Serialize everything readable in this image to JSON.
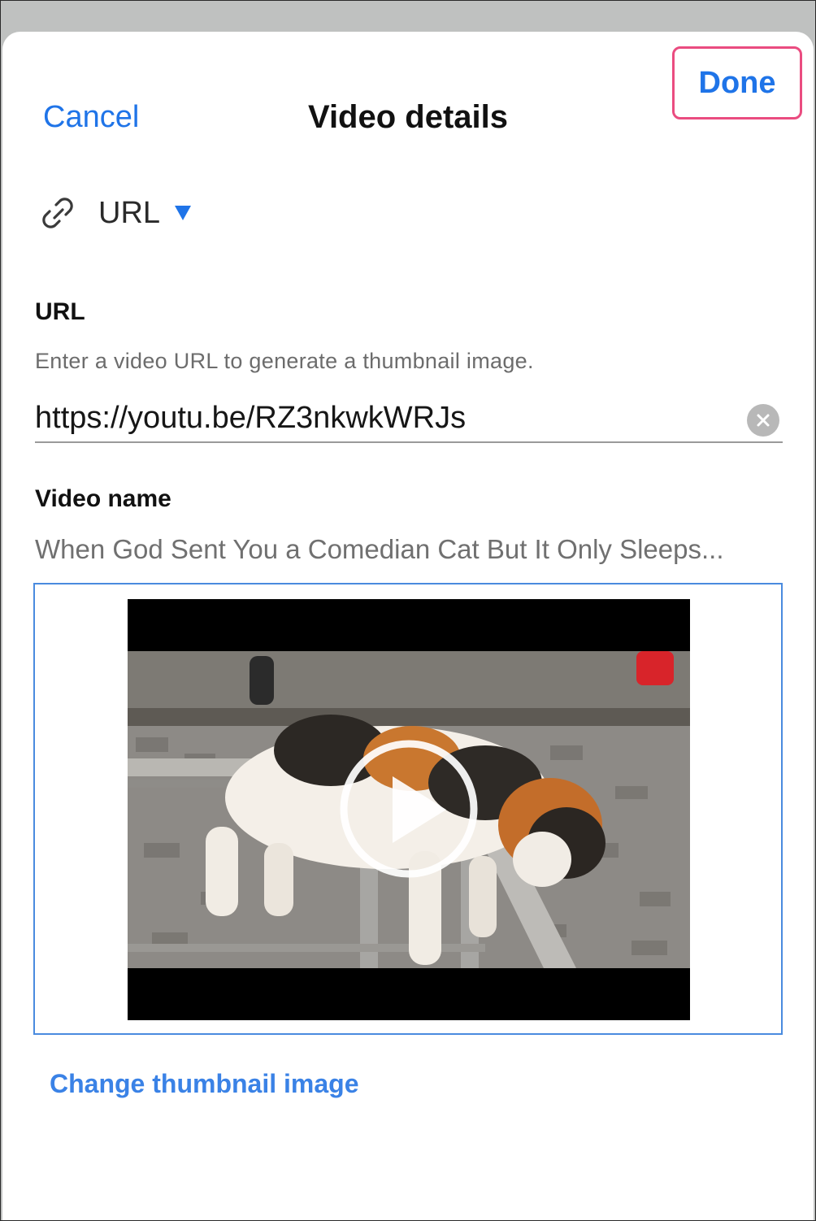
{
  "header": {
    "cancel_label": "Cancel",
    "title": "Video details",
    "done_label": "Done"
  },
  "source": {
    "icon": "link-icon",
    "selected_label": "URL"
  },
  "url_section": {
    "heading": "URL",
    "helper_text": "Enter a video URL to generate a thumbnail image.",
    "value": "https://youtu.be/RZ3nkwkWRJs"
  },
  "video_name": {
    "heading": "Video name",
    "value": "When God Sent You a Comedian Cat But It Only Sleeps..."
  },
  "thumbnail": {
    "icon": "play-icon"
  },
  "actions": {
    "change_thumbnail_label": "Change thumbnail image"
  },
  "colors": {
    "accent": "#1f74e8",
    "highlight": "#ea4c80",
    "thumb_border": "#4a8bdf"
  }
}
